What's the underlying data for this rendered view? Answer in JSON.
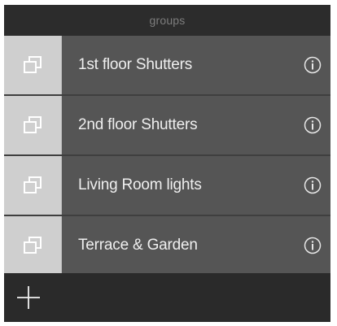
{
  "header": {
    "title": "groups"
  },
  "groups": [
    {
      "label": "1st floor Shutters",
      "icon": "group-squares-icon",
      "action_icon": "info-icon"
    },
    {
      "label": "2nd floor Shutters",
      "icon": "group-squares-icon",
      "action_icon": "info-icon"
    },
    {
      "label": "Living Room lights",
      "icon": "group-squares-icon",
      "action_icon": "info-icon"
    },
    {
      "label": "Terrace & Garden",
      "icon": "group-squares-icon",
      "action_icon": "info-icon"
    }
  ],
  "footer": {
    "add_icon": "plus-icon"
  },
  "colors": {
    "header_bg": "#2c2c2c",
    "icon_cell_bg": "#cfcfcf",
    "row_bg": "#555555",
    "text": "#efefef",
    "footer_bg": "#2a2a2a"
  }
}
